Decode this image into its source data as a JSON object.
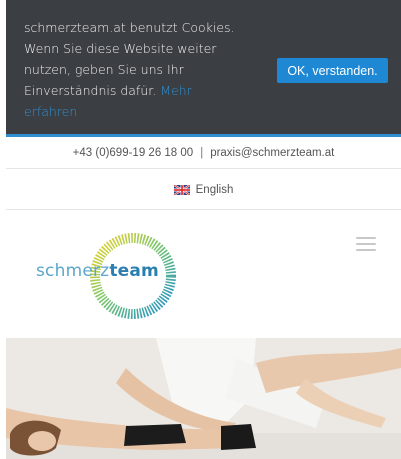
{
  "cookie": {
    "message": "schmerzteam.at benutzt Cookies. Wenn Sie diese Website weiter nutzen, geben Sie uns Ihr Einverständnis dafür.",
    "more_link": "Mehr erfahren",
    "accept_label": "OK, verstanden."
  },
  "topbar": {
    "phone": "+43 (0)699-19 26 18 00",
    "separator": "|",
    "email": "praxis@schmerzteam.at"
  },
  "language": {
    "label": "English",
    "flag_icon": "uk-flag-icon"
  },
  "logo": {
    "text_light": "schmerz",
    "text_bold": "team"
  },
  "menu": {
    "icon": "hamburger-icon"
  },
  "colors": {
    "cookie_bg": "#3b3e42",
    "accent_blue": "#1e88d4",
    "logo_blue": "#2a7fb0",
    "logo_yellow": "#f2d22a"
  }
}
